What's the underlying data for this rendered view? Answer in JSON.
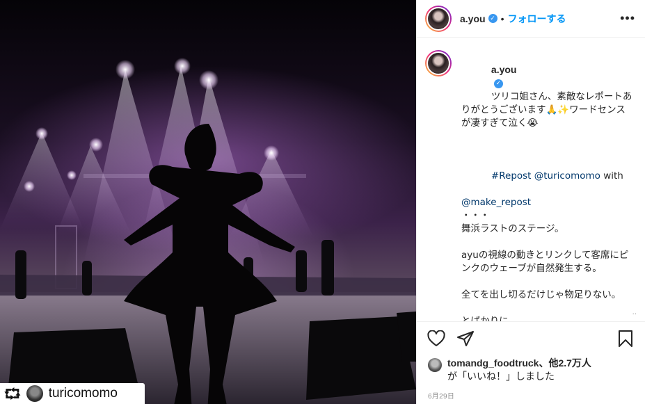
{
  "post": {
    "username": "a.you",
    "verified_mark": "✓",
    "separator": "•",
    "follow_label": "フォローする",
    "more_icon": "•••"
  },
  "photo": {
    "description_icon": "concert-stage-photo",
    "repost_icon": "⮔",
    "repost_username": "turicomomo"
  },
  "caption": {
    "username": "a.you",
    "text_main": "ツリコ姐さん、素敵なレポートありがとうございます🙏✨ワードセンスが凄すぎて泣く😭",
    "hashtag": "#Repost @turicomomo",
    "with_text": " with",
    "mention": "@make_repost",
    "dots": "・・・",
    "body": "舞浜ラストのステージ。\n\nayuの視線の動きとリンクして客席にピンクのウェーブが自然発生する。\n\n全てを出し切るだけじゃ物足りない。\n\nとばかりに、\nayuの中のリミッターが振り切れた瞬間、それは起こった。\n\n最強ギアの浜崎あゆみにダンサーズが続く。"
  },
  "actions": {
    "like_icon": "heart-icon",
    "share_icon": "send-icon",
    "save_icon": "bookmark-icon"
  },
  "likes": {
    "username": "tomandg_foodtruck",
    "others": "、他2.7万人",
    "suffix": "が「いいね！」しました"
  },
  "date": "6月29日"
}
